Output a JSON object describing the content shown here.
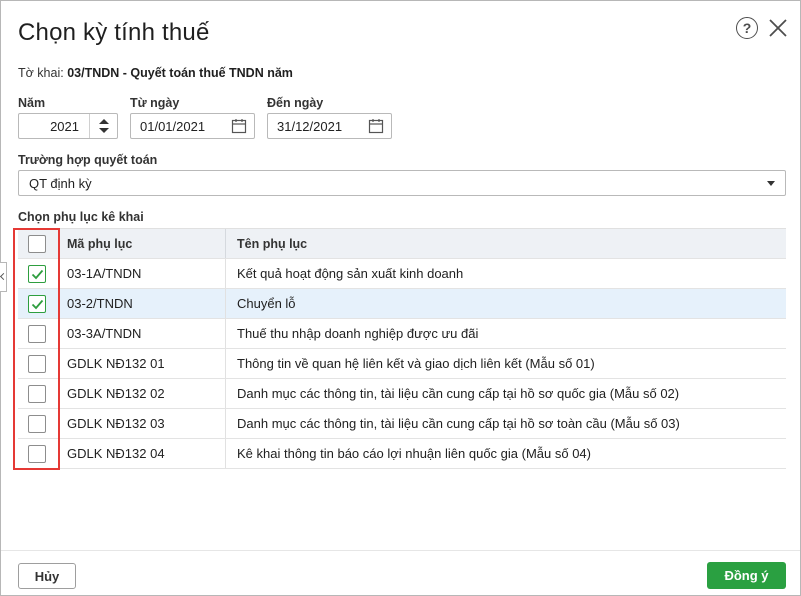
{
  "dialog": {
    "title": "Chọn kỳ tính thuế",
    "help_symbol": "?",
    "declaration_label": "Tờ khai:",
    "declaration_value": "03/TNDN - Quyết toán thuế TNDN năm"
  },
  "fields": {
    "year_label": "Năm",
    "year_value": "2021",
    "from_label": "Từ ngày",
    "from_value": "01/01/2021",
    "to_label": "Đến ngày",
    "to_value": "31/12/2021",
    "settlement_label": "Trường hợp quyết toán",
    "settlement_value": "QT định kỳ"
  },
  "appendix": {
    "section_label": "Chọn phụ lục kê khai",
    "col_code": "Mã phụ lục",
    "col_name": "Tên phụ lục",
    "rows": [
      {
        "code": "03-1A/TNDN",
        "name": "Kết quả hoạt động sản xuất kinh doanh",
        "checked": true
      },
      {
        "code": "03-2/TNDN",
        "name": "Chuyển lỗ",
        "checked": true
      },
      {
        "code": "03-3A/TNDN",
        "name": "Thuế thu nhập doanh nghiệp được ưu đãi",
        "checked": false
      },
      {
        "code": "GDLK NĐ132 01",
        "name": "Thông tin về quan hệ liên kết và giao dịch liên kết (Mẫu số 01)",
        "checked": false
      },
      {
        "code": "GDLK NĐ132 02",
        "name": "Danh mục các thông tin, tài liệu cần cung cấp tại hồ sơ quốc gia (Mẫu số 02)",
        "checked": false
      },
      {
        "code": "GDLK NĐ132 03",
        "name": "Danh mục các thông tin, tài liệu cần cung cấp tại hồ sơ toàn cầu (Mẫu số 03)",
        "checked": false
      },
      {
        "code": "GDLK NĐ132 04",
        "name": "Kê khai thông tin báo cáo lợi nhuận liên quốc gia (Mẫu số 04)",
        "checked": false
      }
    ]
  },
  "footer": {
    "cancel_label": "Hủy",
    "ok_label": "Đồng ý"
  },
  "colors": {
    "accent_green": "#2aa041",
    "highlight_red": "#e53935",
    "selected_row": "#e6f1fb"
  }
}
